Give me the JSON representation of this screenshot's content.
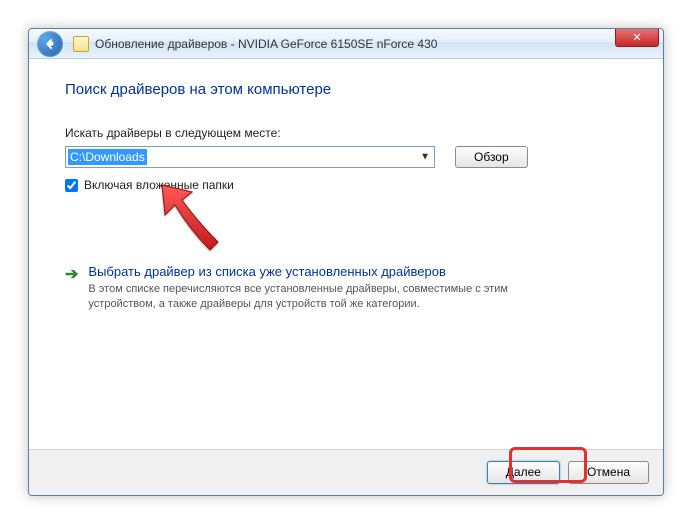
{
  "window": {
    "title": "Обновление драйверов - NVIDIA GeForce 6150SE nForce 430",
    "close_label": "✕"
  },
  "main": {
    "heading": "Поиск драйверов на этом компьютере",
    "search_label": "Искать драйверы в следующем месте:",
    "path_value": "C:\\Downloads",
    "browse_label": "Обзор",
    "include_subfolders_label": "Включая вложенные папки",
    "include_subfolders_checked": true
  },
  "option": {
    "title": "Выбрать драйвер из списка уже установленных драйверов",
    "description": "В этом списке перечисляются все установленные драйверы, совместимые с этим устройством, а также драйверы для устройств той же категории."
  },
  "footer": {
    "next_label": "Далее",
    "cancel_label": "Отмена"
  }
}
